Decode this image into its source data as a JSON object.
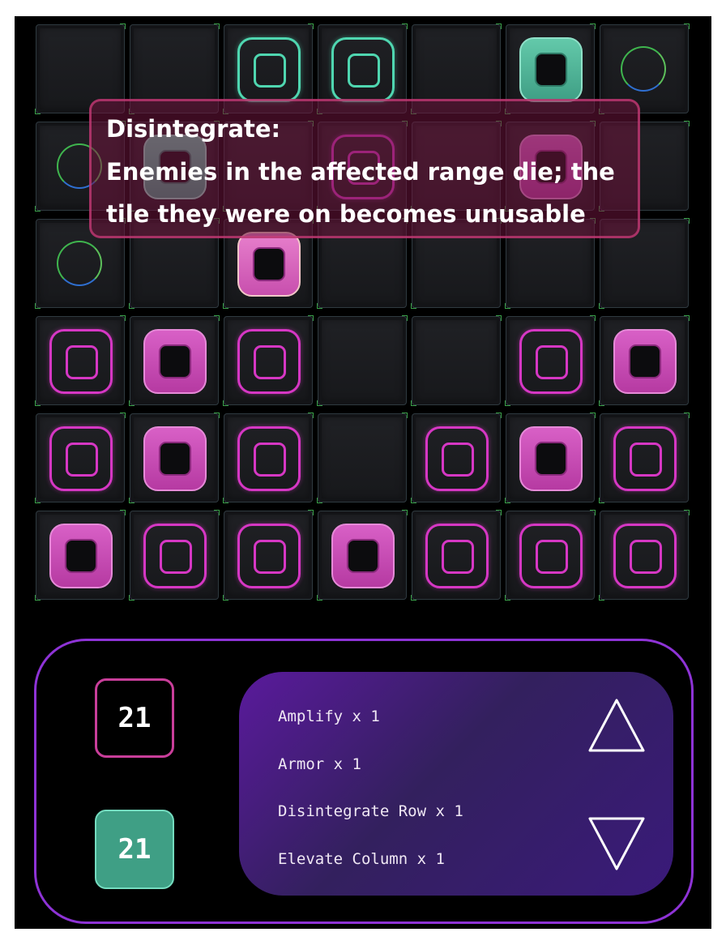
{
  "board": {
    "rows": [
      [
        null,
        null,
        {
          "style": "outline",
          "color": "teal"
        },
        {
          "style": "outline",
          "color": "teal"
        },
        null,
        {
          "style": "filled",
          "color": "teal"
        },
        {
          "style": "ring"
        }
      ],
      [
        {
          "style": "ring"
        },
        {
          "style": "filled",
          "color": "teal"
        },
        null,
        {
          "style": "outline",
          "color": "pink"
        },
        null,
        {
          "style": "filled",
          "color": "pink"
        },
        null
      ],
      [
        {
          "style": "ring"
        },
        null,
        {
          "style": "filled",
          "color": "pale"
        },
        null,
        null,
        null,
        null
      ],
      [
        {
          "style": "outline",
          "color": "pink"
        },
        {
          "style": "filled",
          "color": "pink"
        },
        {
          "style": "outline",
          "color": "pink"
        },
        null,
        null,
        {
          "style": "outline",
          "color": "pink"
        },
        {
          "style": "filled",
          "color": "pink"
        }
      ],
      [
        {
          "style": "outline",
          "color": "pink"
        },
        {
          "style": "filled",
          "color": "pink"
        },
        {
          "style": "outline",
          "color": "pink"
        },
        null,
        {
          "style": "outline",
          "color": "pink"
        },
        {
          "style": "filled",
          "color": "pink"
        },
        {
          "style": "outline",
          "color": "pink"
        }
      ],
      [
        {
          "style": "filled",
          "color": "pink"
        },
        {
          "style": "outline",
          "color": "pink"
        },
        {
          "style": "outline",
          "color": "pink"
        },
        {
          "style": "filled",
          "color": "pink"
        },
        {
          "style": "outline",
          "color": "pink"
        },
        {
          "style": "outline",
          "color": "pink"
        },
        {
          "style": "outline",
          "color": "pink"
        }
      ]
    ]
  },
  "tooltip": {
    "title": "Disintegrate:",
    "line1": "Enemies in the affected range die; the",
    "line2": "tile they were on becomes unusable"
  },
  "hud": {
    "enemy_count": "21",
    "player_count": "21",
    "cards": [
      "Amplify x 1",
      "Armor x 1",
      "Disintegrate Row x 1",
      "Elevate Column x 1"
    ]
  },
  "colors": {
    "pink": "#d637c4",
    "teal": "#4fd6b0",
    "hud_border": "#8e33d6"
  },
  "icons": {
    "scroll_up": "triangle-up-icon",
    "scroll_down": "triangle-down-icon"
  }
}
